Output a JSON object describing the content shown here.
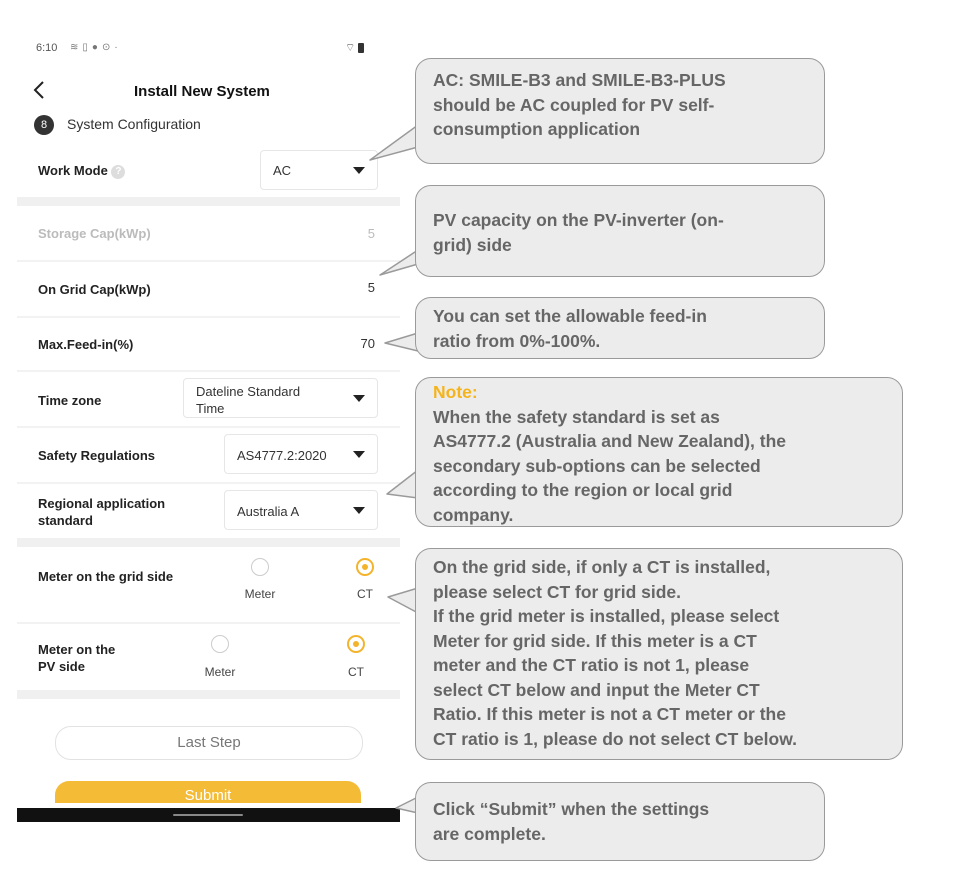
{
  "status_bar": {
    "time": "6:10",
    "icons": [
      "wifi-icon",
      "sim-icon",
      "alert-icon",
      "settings-icon"
    ],
    "right_icons": [
      "wifi-icon",
      "battery-icon"
    ]
  },
  "header": {
    "title": "Install New System",
    "step_number": "8",
    "step_label": "System Configuration"
  },
  "form": {
    "work_mode": {
      "label": "Work Mode",
      "value": "AC"
    },
    "storage_cap": {
      "label": "Storage Cap(kWp)",
      "value": "5"
    },
    "on_grid_cap": {
      "label": "On Grid Cap(kWp)",
      "value": "5"
    },
    "max_feed_in": {
      "label": "Max.Feed-in(%)",
      "value": "70"
    },
    "time_zone": {
      "label": "Time zone",
      "value_line1": "Dateline Standard",
      "value_line2": "Time"
    },
    "safety_regulations": {
      "label": "Safety Regulations",
      "value": "AS4777.2:2020"
    },
    "regional_standard": {
      "label_line1": "Regional application",
      "label_line2": "standard",
      "value": "Australia A"
    },
    "meter_grid": {
      "label": "Meter on the grid side",
      "option_meter": "Meter",
      "option_ct": "CT",
      "selected": "CT"
    },
    "meter_pv": {
      "label_line1": "Meter on the",
      "label_line2": "PV side",
      "option_meter": "Meter",
      "option_ct": "CT",
      "selected": "CT"
    }
  },
  "buttons": {
    "last_step": "Last Step",
    "submit": "Submit"
  },
  "callouts": {
    "ac": [
      "AC: SMILE-B3 and SMILE-B3-PLUS",
      "should be AC coupled for PV self-",
      "consumption application"
    ],
    "pv_capacity": [
      "PV capacity on the PV-inverter (on-",
      "grid) side"
    ],
    "feed_in": [
      "You can set the allowable feed-in",
      "ratio from 0%-100%."
    ],
    "note": {
      "title": "Note:",
      "lines": [
        "When the safety standard is set as",
        "AS4777.2 (Australia and New Zealand), the",
        "secondary sub-options can be selected",
        "according to the region or local grid",
        "company."
      ]
    },
    "meter": [
      "On the grid side, if only a CT is installed,",
      "please select CT for grid side.",
      "If the grid meter is installed, please select",
      "Meter for grid side. If this meter is a CT",
      "meter and the CT ratio is not 1, please",
      "select CT below and input the Meter CT",
      "Ratio. If this meter is not a CT meter or the",
      "CT ratio is 1, please do not select CT below."
    ],
    "submit": [
      "Click “Submit” when the settings",
      "are complete."
    ]
  },
  "colors": {
    "accent": "#f4bb36",
    "note_title": "#f5b41b",
    "callout_bg": "#ececec",
    "callout_text": "#666666"
  }
}
